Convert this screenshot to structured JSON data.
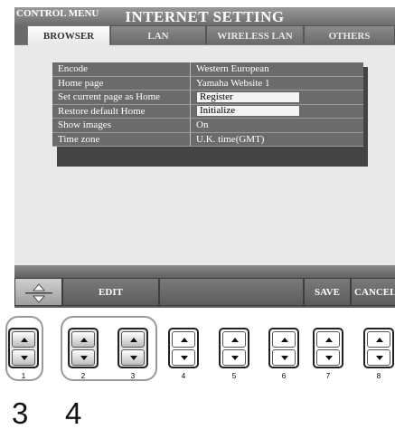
{
  "title": "INTERNET SETTING",
  "tabs": [
    {
      "label": "BROWSER",
      "active": true
    },
    {
      "label": "LAN",
      "active": false
    },
    {
      "label": "WIRELESS LAN",
      "active": false
    },
    {
      "label": "OTHERS",
      "active": false
    }
  ],
  "settings": [
    {
      "label": "Encode",
      "value": "Western European",
      "type": "text"
    },
    {
      "label": "Home page",
      "value": "Yamaha Website 1",
      "type": "text"
    },
    {
      "label": "Set current page as Home",
      "value": "Register",
      "type": "button"
    },
    {
      "label": "Restore default Home",
      "value": "Initialize",
      "type": "button"
    },
    {
      "label": "Show images",
      "value": "On",
      "type": "text"
    },
    {
      "label": "Time zone",
      "value": "U.K. time(GMT)",
      "type": "text"
    }
  ],
  "control_menu": {
    "label": "CONTROL MENU",
    "edit_label": "EDIT",
    "save_label": "SAVE",
    "cancel_label": "CANCEL",
    "updown_icon": "up-down-arrows-icon"
  },
  "physical_buttons": [
    "1",
    "2",
    "3",
    "4",
    "5",
    "6",
    "7",
    "8"
  ],
  "callouts": [
    "3",
    "4"
  ],
  "colors": {
    "screen_bg": "#6a6a6a",
    "content_bg": "#e9e9e9",
    "group_outline": "#9a9a9a"
  }
}
